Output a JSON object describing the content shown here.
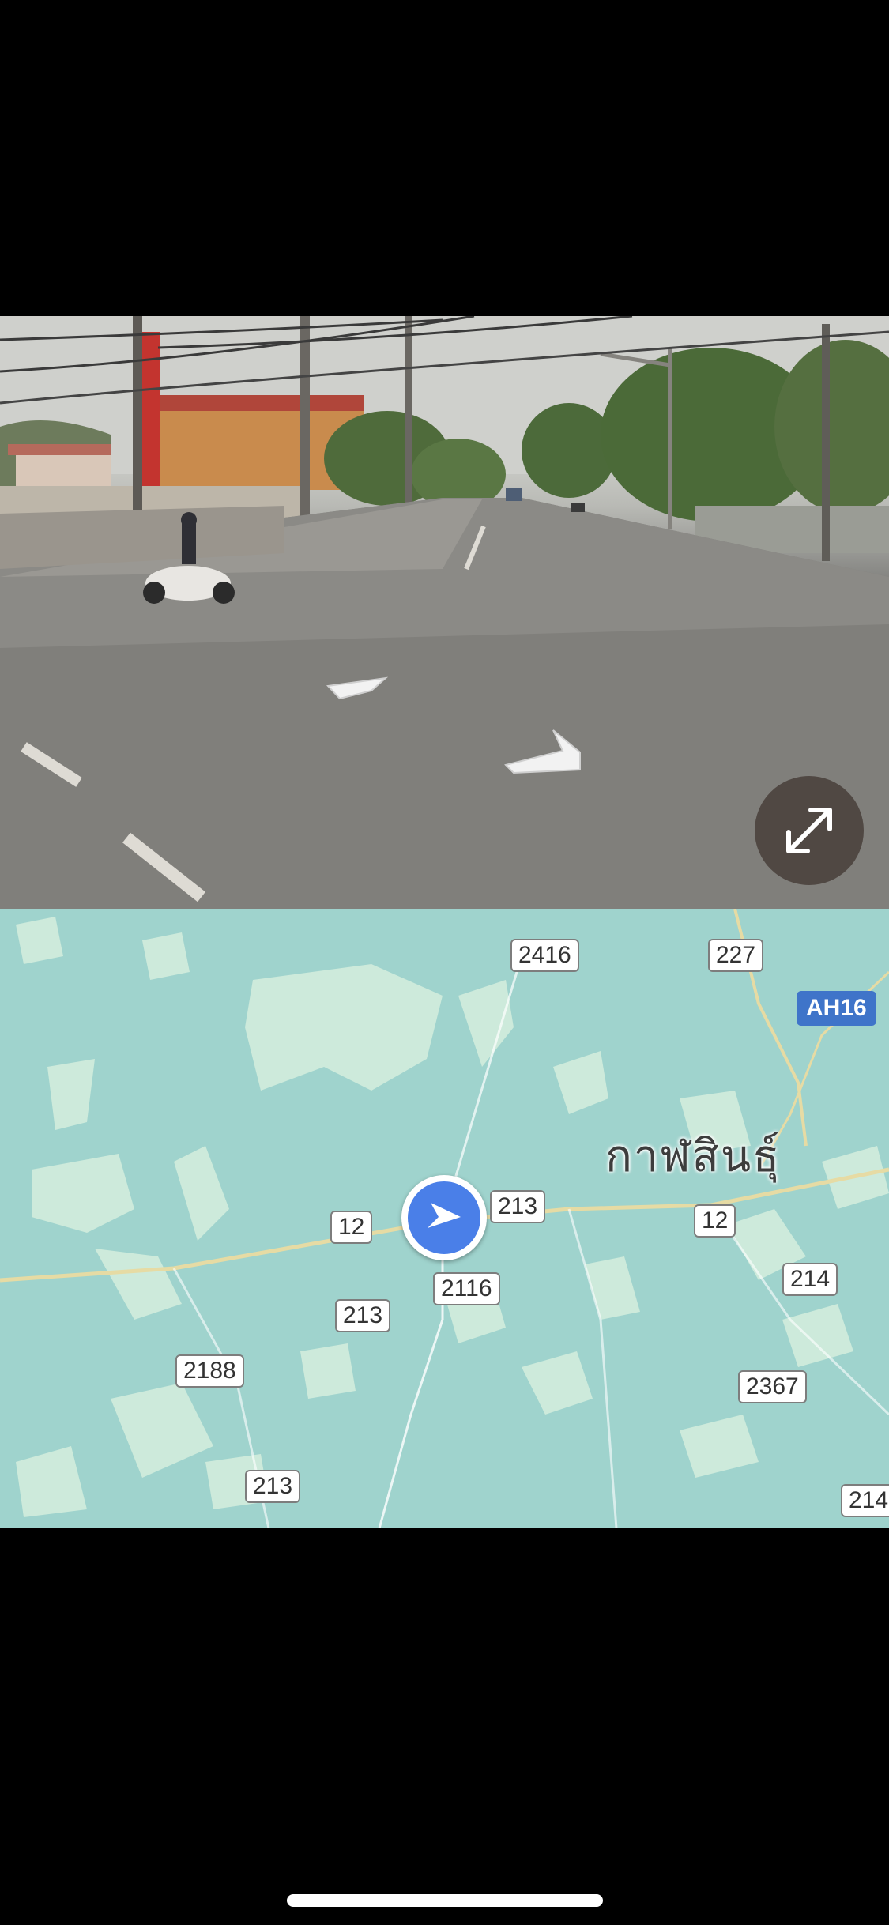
{
  "street_view": {
    "expand_icon": "expand-arrows-icon"
  },
  "map": {
    "city_label": "กาฬสินธุ์",
    "asian_highway": "AH16",
    "route_shields": [
      "2416",
      "227",
      "12",
      "213",
      "12",
      "2116",
      "213",
      "214",
      "2188",
      "2367",
      "213",
      "214"
    ],
    "current_location_icon": "navigation-arrow-icon",
    "colors": {
      "water": "#9fd3cd",
      "land": "#cdeadb",
      "route_marker": "#4a7fe8",
      "asian_highway": "#3f74c9"
    }
  },
  "home_indicator": "home-indicator"
}
